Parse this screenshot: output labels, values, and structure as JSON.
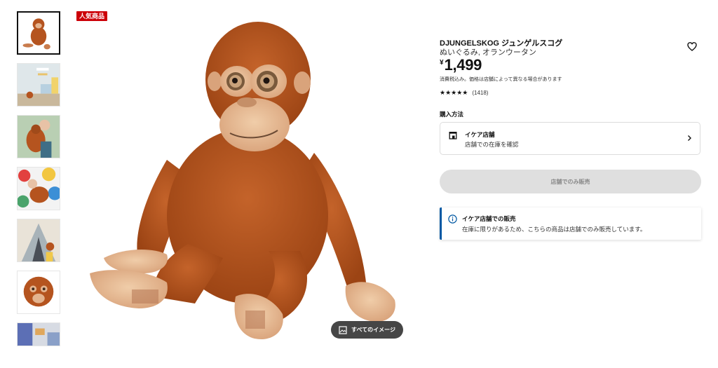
{
  "badge": "人気商品",
  "gallery": {
    "thumbnails": [
      {
        "alt": "orangutan-plush-front"
      },
      {
        "alt": "kids-room-scene"
      },
      {
        "alt": "child-holding-orangutan"
      },
      {
        "alt": "child-on-colorful-cushions"
      },
      {
        "alt": "play-tent-scene"
      },
      {
        "alt": "orangutan-face-closeup"
      },
      {
        "alt": "room-scene-partial"
      }
    ],
    "all_images_label": "すべてのイメージ"
  },
  "product": {
    "name": "DJUNGELSKOG ジュンゲルスコグ",
    "description": "ぬいぐるみ, オランウータン",
    "currency": "¥",
    "price": "1,499",
    "tax_note": "消費税込み。価格は店舗によって異なる場合があります",
    "rating": {
      "stars": "★★★★★",
      "count": "(1418)"
    }
  },
  "purchase": {
    "title": "購入方法",
    "store": {
      "title": "イケア店舗",
      "subtitle": "店舗での在庫を確認"
    },
    "store_only_button": "店舗でのみ販売"
  },
  "info": {
    "heading": "イケア店舗での販売",
    "body": "在庫に限りがあるため、こちらの商品は店舗でのみ販売しています。"
  },
  "colors": {
    "badge": "#cc0008",
    "info_accent": "#0058a3",
    "plush": "#b5541f"
  }
}
